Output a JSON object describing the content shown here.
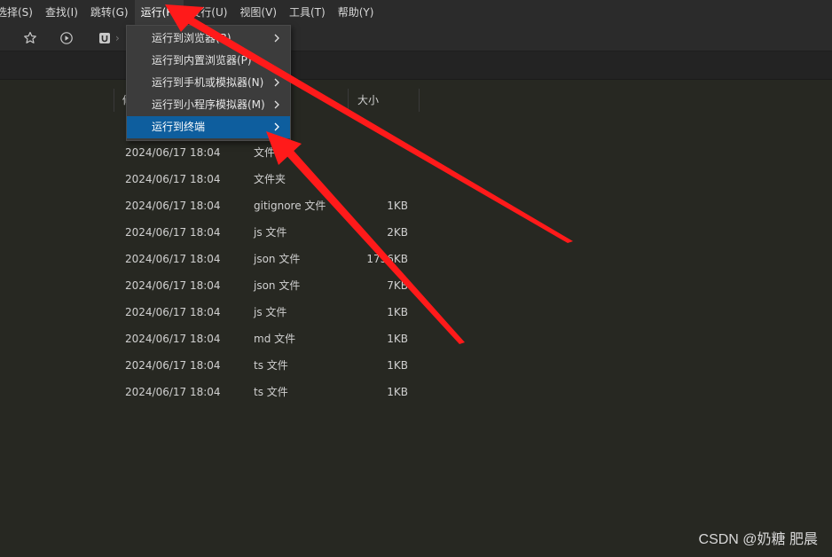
{
  "menubar": {
    "items": [
      "选择(S)",
      "查找(I)",
      "跳转(G)",
      "运行(R)",
      "发行(U)",
      "视图(V)",
      "工具(T)",
      "帮助(Y)"
    ],
    "active_index": 3
  },
  "toolbar": {
    "icons": [
      "star-icon",
      "play-circle-icon",
      "app-icon",
      "chevron-right-icon"
    ]
  },
  "run_menu": {
    "items": [
      {
        "label": "运行到浏览器(B)",
        "has_submenu": true
      },
      {
        "label": "运行到内置浏览器(P)",
        "has_submenu": false
      },
      {
        "label": "运行到手机或模拟器(N)",
        "has_submenu": true
      },
      {
        "label": "运行到小程序模拟器(M)",
        "has_submenu": true
      },
      {
        "label": "运行到终端",
        "has_submenu": true
      }
    ],
    "highlight_index": 4
  },
  "table": {
    "headers": {
      "name_partial": "修",
      "size": "大小"
    },
    "rows": [
      {
        "date": "2024/06/17 18:04",
        "type": "文件夹",
        "size": ""
      },
      {
        "date": "2024/06/17 18:04",
        "type": "文件夹",
        "size": ""
      },
      {
        "date": "2024/06/17 18:04",
        "type": "gitignore 文件",
        "size": "1KB"
      },
      {
        "date": "2024/06/17 18:04",
        "type": "js 文件",
        "size": "2KB"
      },
      {
        "date": "2024/06/17 18:04",
        "type": "json 文件",
        "size": "1736KB"
      },
      {
        "date": "2024/06/17 18:04",
        "type": "json 文件",
        "size": "7KB"
      },
      {
        "date": "2024/06/17 18:04",
        "type": "js 文件",
        "size": "1KB"
      },
      {
        "date": "2024/06/17 18:04",
        "type": "md 文件",
        "size": "1KB"
      },
      {
        "date": "2024/06/17 18:04",
        "type": "ts 文件",
        "size": "1KB"
      },
      {
        "date": "2024/06/17 18:04",
        "type": "ts 文件",
        "size": "1KB"
      }
    ]
  },
  "watermark": "CSDN @奶糖 肥晨",
  "colors": {
    "background": "#272822",
    "menu_highlight": "#0e5e9e",
    "arrow": "#ff1a1a"
  }
}
